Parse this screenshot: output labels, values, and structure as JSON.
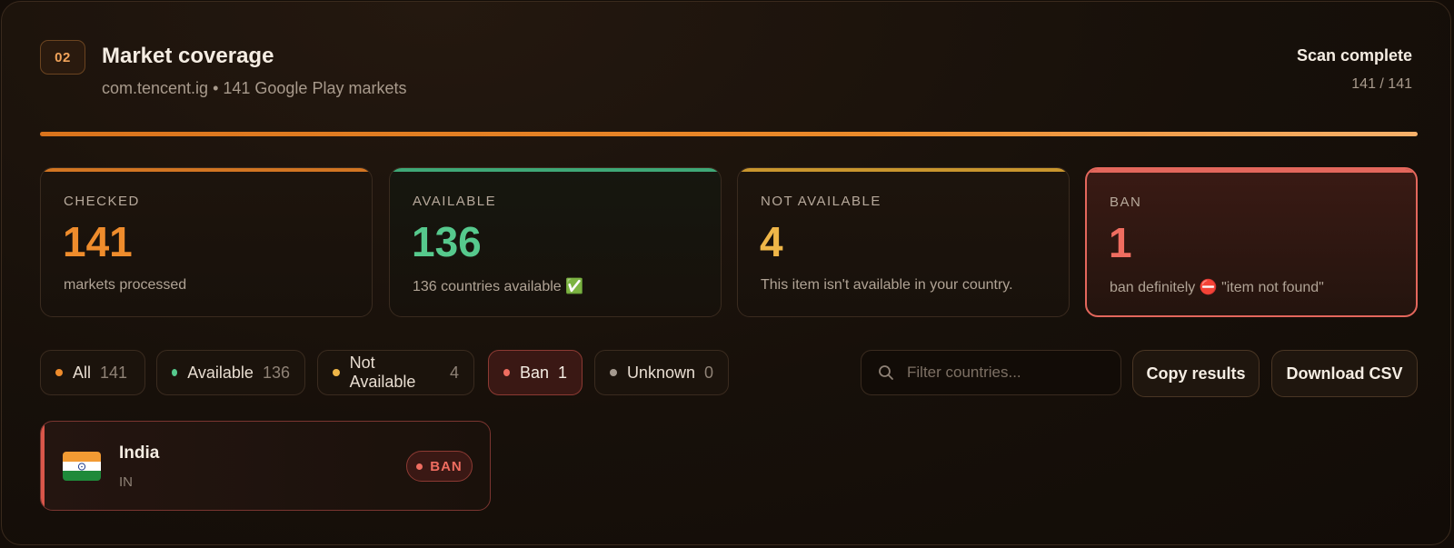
{
  "header": {
    "step": "02",
    "title": "Market coverage",
    "subtitle": "com.tencent.ig • 141 Google Play markets",
    "status": "Scan complete",
    "count": "141 / 141",
    "progress_fraction": 1.0
  },
  "cards": [
    {
      "label": "CHECKED",
      "value": "141",
      "description": "markets processed",
      "color": "#ef8c2c"
    },
    {
      "label": "AVAILABLE",
      "value": "136",
      "description": "136 countries available ✅",
      "color": "#56c98d"
    },
    {
      "label": "NOT AVAILABLE",
      "value": "4",
      "description": "This item isn't available in your country.",
      "color": "#efb648"
    },
    {
      "label": "BAN",
      "value": "1",
      "description": "ban definitely ⛔ \"item not found\"",
      "color": "#ef6d60"
    }
  ],
  "filters": [
    {
      "label": "All",
      "count": "141",
      "color": "#ef8c2c"
    },
    {
      "label": "Available",
      "count": "136",
      "color": "#56c98d"
    },
    {
      "label": "Not Available",
      "count": "4",
      "color": "#efb648"
    },
    {
      "label": "Ban",
      "count": "1",
      "color": "#ef6d60",
      "active": true
    },
    {
      "label": "Unknown",
      "count": "0",
      "color": "#a59a8f"
    }
  ],
  "search": {
    "placeholder": "Filter countries...",
    "icon": "search-icon"
  },
  "actions": {
    "copy": "Copy results",
    "download": "Download CSV"
  },
  "results": [
    {
      "name": "India",
      "code": "IN",
      "status": "BAN",
      "flag_icon": "india-flag-icon"
    }
  ]
}
